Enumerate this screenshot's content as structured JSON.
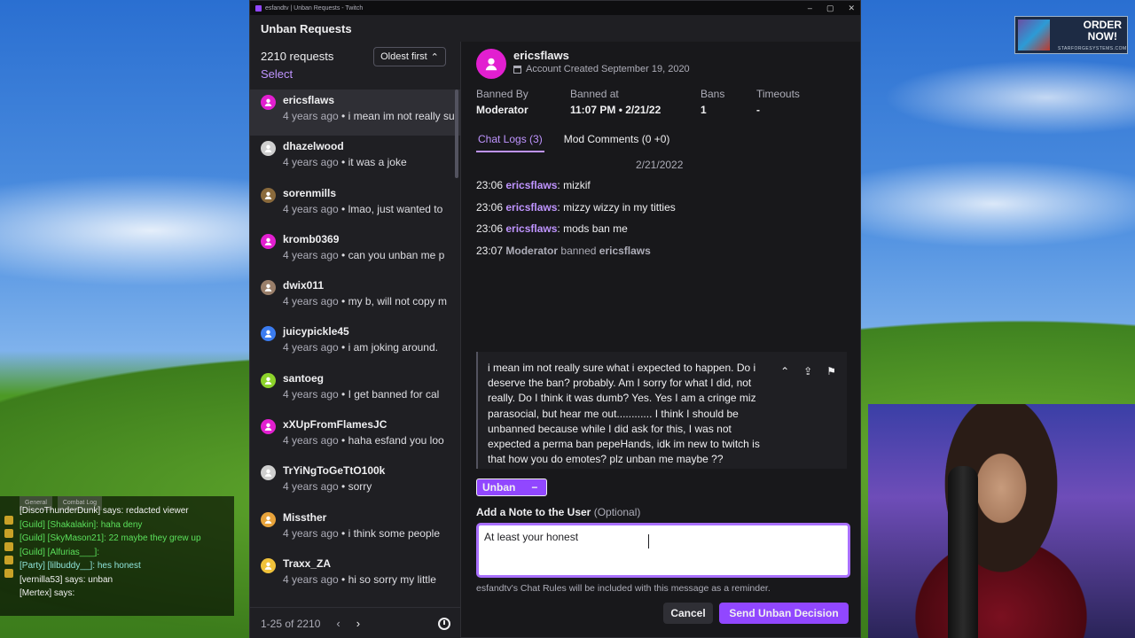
{
  "window": {
    "title": "esfandtv | Unban Requests - Twitch",
    "header": "Unban Requests"
  },
  "left_panel": {
    "count": "2210 requests",
    "select": "Select",
    "sort": "Oldest first",
    "requests": [
      {
        "name": "ericsflaws",
        "ago": "4 years ago",
        "message": "i mean im not really sure what i expected",
        "avatar_color": "#e21fd0"
      },
      {
        "name": "dhazelwood",
        "ago": "4 years ago",
        "message": "it was a joke",
        "avatar_color": "#cfcfcf"
      },
      {
        "name": "sorenmills",
        "ago": "4 years ago",
        "message": "lmao, just wanted to",
        "avatar_color": "#8a6a3c"
      },
      {
        "name": "kromb0369",
        "ago": "4 years ago",
        "message": "can you unban me p",
        "avatar_color": "#e21fd0"
      },
      {
        "name": "dwix011",
        "ago": "4 years ago",
        "message": "my b, will not copy m",
        "avatar_color": "#9a7f6a"
      },
      {
        "name": "juicypickle45",
        "ago": "4 years ago",
        "message": "i am joking around.",
        "avatar_color": "#3b7cf0"
      },
      {
        "name": "santoeg",
        "ago": "4 years ago",
        "message": "I get banned for cal",
        "avatar_color": "#8dd32b"
      },
      {
        "name": "xXUpFromFlamesJC",
        "ago": "4 years ago",
        "message": "haha esfand you loo",
        "avatar_color": "#e21fd0"
      },
      {
        "name": "TrYiNgToGeTtO100k",
        "ago": "4 years ago",
        "message": "sorry",
        "avatar_color": "#cfcfcf"
      },
      {
        "name": "Missther",
        "ago": "4 years ago",
        "message": "i think some people",
        "avatar_color": "#e8a33b"
      },
      {
        "name": "Traxx_ZA",
        "ago": "4 years ago",
        "message": "hi so sorry my little",
        "avatar_color": "#f0c23b"
      }
    ],
    "pager": "1-25 of 2210"
  },
  "detail": {
    "username": "ericsflaws",
    "created": "Account Created September 19, 2020",
    "stats": {
      "banned_by_label": "Banned By",
      "banned_by": "Moderator",
      "banned_at_label": "Banned at",
      "banned_at": "11:07 PM • 2/21/22",
      "bans_label": "Bans",
      "bans": "1",
      "timeouts_label": "Timeouts",
      "timeouts": "-"
    },
    "tabs": {
      "chat_logs": "Chat Logs (3)",
      "mod_comments": "Mod Comments (0 +0)"
    },
    "log_date": "2/21/2022",
    "logs": [
      {
        "time": "23:06",
        "user": "ericsflaws",
        "text": ": mizkif"
      },
      {
        "time": "23:06",
        "user": "ericsflaws",
        "text": ": mizzy wizzy in my titties"
      },
      {
        "time": "23:06",
        "user": "ericsflaws",
        "text": ": mods ban me"
      }
    ],
    "ban_line": {
      "time": "23:07",
      "mod": "Moderator",
      "action": "banned",
      "target": "ericsflaws"
    },
    "request_text": "i mean im not really sure what i expected to happen. Do i deserve the ban? probably. Am I sorry for what I did, not really. Do I think it was dumb? Yes. Yes I am a cringe miz parasocial, but hear me out............ I think I should be unbanned because while I did ask for this, I was not expected a perma ban pepeHands, idk im new to twitch is that how you do emotes? plz unban me maybe ??",
    "unban": "Unban",
    "note_label": "Add a Note to the User",
    "note_optional": "(Optional)",
    "note_value": "At least your honest",
    "rules_note": "esfandtv's Chat Rules will be included with this message as a reminder.",
    "cancel": "Cancel",
    "send": "Send Unban Decision"
  },
  "overlay_chat": {
    "tabs": [
      "General",
      "Combat Log"
    ],
    "lines": [
      {
        "text": "[DiscoThunderDunk] says: redacted viewer",
        "color": "#f2f2f2"
      },
      {
        "text": "[Guild] [Shakalakin]: haha deny",
        "color": "#5be05b"
      },
      {
        "text": "[Guild] [SkyMason21]: 22 maybe they grew up",
        "color": "#5be05b"
      },
      {
        "text": "[Guild] [Alfurias___]:",
        "color": "#5be05b"
      },
      {
        "text": "[Party] [lilbuddy__]: hes honest",
        "color": "#8ee3d8"
      },
      {
        "text": "[vernilla53] says: unban",
        "color": "#f2f2f2"
      },
      {
        "text": "[Mertex] says:",
        "color": "#f2f2f2"
      }
    ]
  },
  "ad": {
    "line1": "ORDER",
    "line2": "NOW!",
    "brand": "STARFORGESYSTEMS.COM"
  }
}
